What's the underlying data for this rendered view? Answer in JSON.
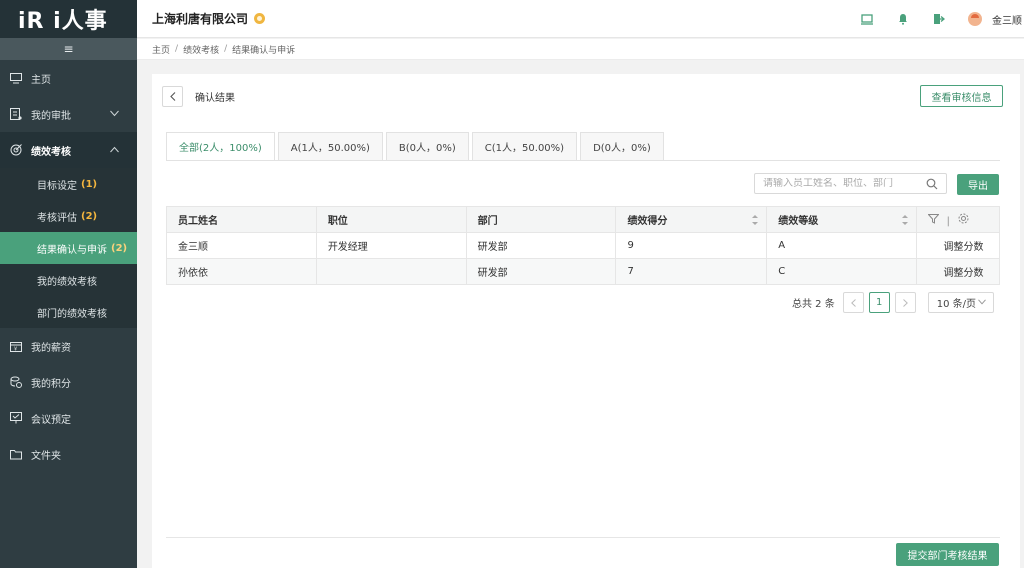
{
  "brand": {
    "logo_text": "iR i人事"
  },
  "sidebar": {
    "collapse_icon": "menu-icon",
    "items": [
      {
        "label": "主页",
        "icon": "monitor-icon"
      },
      {
        "label": "我的审批",
        "icon": "approval-icon"
      },
      {
        "label": "绩效考核",
        "icon": "target-icon",
        "children": [
          {
            "label": "目标设定",
            "count": "(1)"
          },
          {
            "label": "考核评估",
            "count": "(2)"
          },
          {
            "label": "结果确认与申诉",
            "count": "(2)",
            "active": true
          },
          {
            "label": "我的绩效考核",
            "count": ""
          },
          {
            "label": "部门的绩效考核",
            "count": ""
          }
        ]
      },
      {
        "label": "我的薪资",
        "icon": "wallet-icon"
      },
      {
        "label": "我的积分",
        "icon": "coins-icon"
      },
      {
        "label": "会议预定",
        "icon": "meeting-icon"
      },
      {
        "label": "文件夹",
        "icon": "folder-icon"
      }
    ]
  },
  "header": {
    "company": "上海利唐有限公司",
    "username": "金三顺"
  },
  "breadcrumb": [
    "主页",
    "绩效考核",
    "结果确认与申诉"
  ],
  "panel": {
    "title": "确认结果",
    "view_audit_button": "查看审核信息",
    "tabs": [
      "全部(2人，100%)",
      "A(1人，50.00%)",
      "B(0人，0%)",
      "C(1人，50.00%)",
      "D(0人，0%)"
    ],
    "search_placeholder": "请输入员工姓名、职位、部门",
    "export_button": "导出",
    "table": {
      "headers": [
        "员工姓名",
        "职位",
        "部门",
        "绩效得分",
        "绩效等级"
      ],
      "rows": [
        {
          "name": "金三顺",
          "position": "开发经理",
          "dept": "研发部",
          "score": "9",
          "grade": "A",
          "action": "调整分数"
        },
        {
          "name": "孙依依",
          "position": "",
          "dept": "研发部",
          "score": "7",
          "grade": "C",
          "action": "调整分数"
        }
      ]
    },
    "pagination": {
      "total": "总共 2 条",
      "current_page": "1",
      "page_size": "10 条/页"
    },
    "submit_button": "提交部门考核结果"
  },
  "colors": {
    "accent": "#4aa17c",
    "sidebar": "#2f3d42",
    "badge": "#f4b63e"
  }
}
